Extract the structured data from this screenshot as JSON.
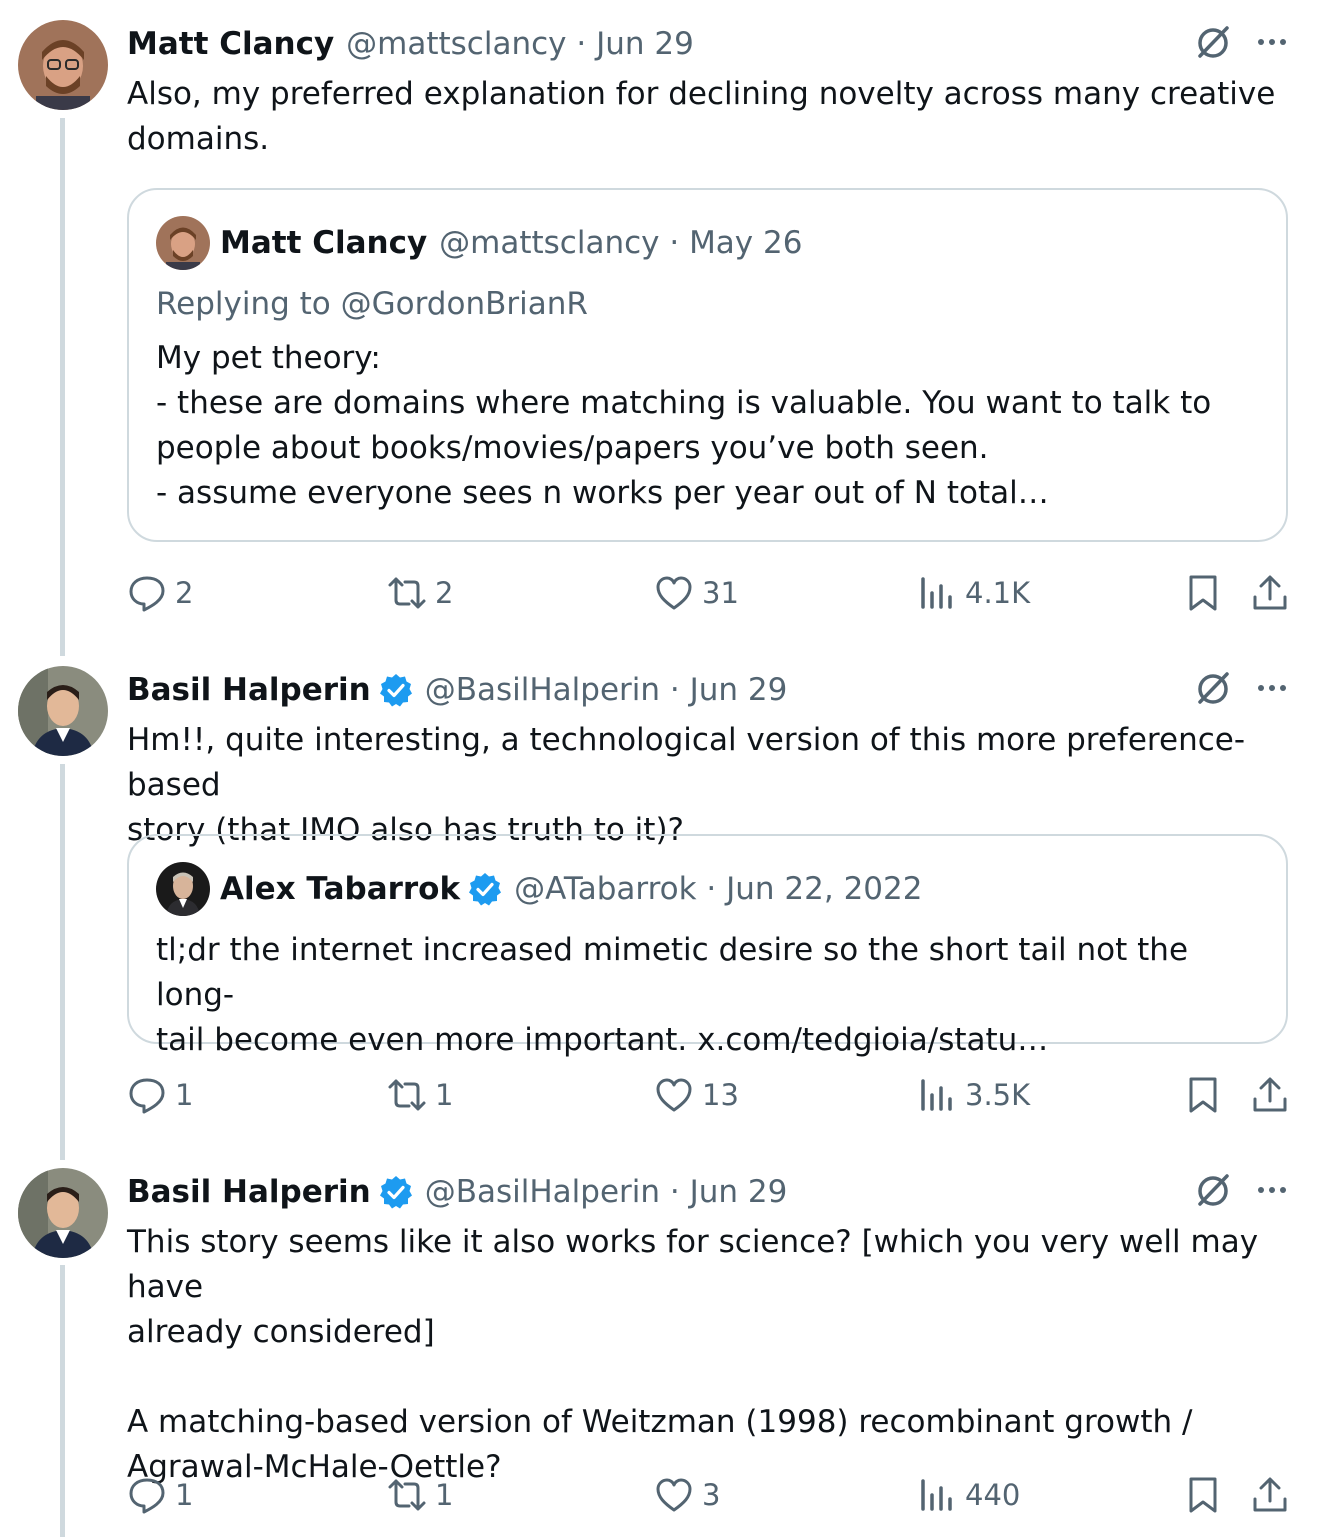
{
  "tweets": [
    {
      "name": "Matt Clancy",
      "handle": "@mattsclancy · Jun 29",
      "verified": false,
      "text": "Also, my preferred explanation for declining novelty across many creative\ndomains.",
      "quote": {
        "name": "Matt Clancy",
        "handle": "@mattsclancy · May 26",
        "replying": "Replying to @GordonBrianR",
        "text": "My pet theory:\n- these are domains where matching is valuable. You want to talk to\npeople about books/movies/papers you’ve both seen.\n- assume everyone sees n works per year out of N total…"
      },
      "replies": "2",
      "reposts": "2",
      "likes": "31",
      "views": "4.1K"
    },
    {
      "name": "Basil Halperin",
      "handle": "@BasilHalperin · Jun 29",
      "verified": true,
      "text": "Hm!!, quite interesting, a technological version of this more preference-based\nstory (that IMO also has truth to it)?",
      "quote": {
        "name": "Alex Tabarrok",
        "handle": "@ATabarrok · Jun 22, 2022",
        "text": "tl;dr the internet increased mimetic desire so the short tail not the long-\ntail become even more important. x.com/tedgioia/statu…"
      },
      "replies": "1",
      "reposts": "1",
      "likes": "13",
      "views": "3.5K"
    },
    {
      "name": "Basil Halperin",
      "handle": "@BasilHalperin · Jun 29",
      "verified": true,
      "text": "This story seems like it also works for science? [which you very well may have\nalready considered]\n\nA matching-based version of Weitzman (1998) recombinant growth /\nAgrawal-McHale-Oettle?",
      "replies": "1",
      "reposts": "1",
      "likes": "3",
      "views": "440"
    }
  ],
  "colors": {
    "text": "#0f1419",
    "secondary": "#536471",
    "border": "#cfd9de",
    "verified": "#1d9bf0"
  },
  "icons": [
    "grok-icon",
    "more-icon",
    "reply-icon",
    "repost-icon",
    "like-icon",
    "views-icon",
    "bookmark-icon",
    "share-icon",
    "verified-badge-icon"
  ]
}
